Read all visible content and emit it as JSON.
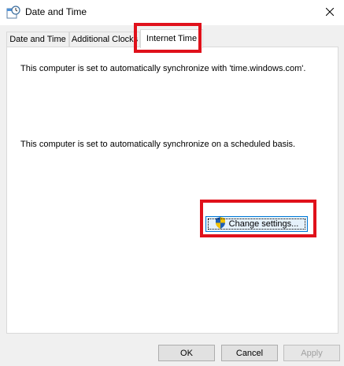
{
  "window": {
    "title": "Date and Time",
    "title_icon": "clock-calendar-icon",
    "close_icon": "close-icon"
  },
  "tabs": [
    {
      "label": "Date and Time",
      "active": false
    },
    {
      "label": "Additional Clocks",
      "active": false
    },
    {
      "label": "Internet Time",
      "active": true
    }
  ],
  "internet_time": {
    "sync_server_text": "This computer is set to automatically synchronize with 'time.windows.com'.",
    "schedule_text": "This computer is set to automatically synchronize on a scheduled basis.",
    "change_settings_label": "Change settings...",
    "change_settings_icon": "uac-shield-icon"
  },
  "footer": {
    "ok_label": "OK",
    "cancel_label": "Cancel",
    "apply_label": "Apply"
  },
  "annotations": {
    "highlight_color": "#e0111b"
  }
}
